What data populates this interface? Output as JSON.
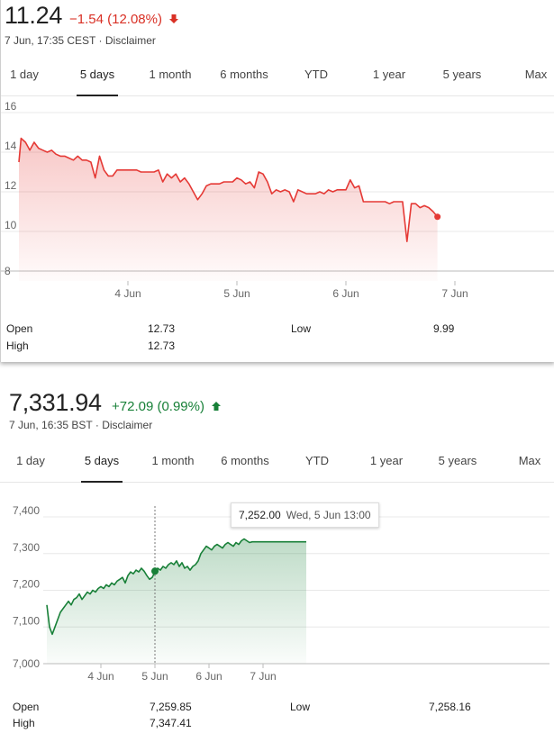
{
  "tabs": [
    "1 day",
    "5 days",
    "1 month",
    "6 months",
    "YTD",
    "1 year",
    "5 years",
    "Max"
  ],
  "active_tab": "5 days",
  "quotes": [
    {
      "price": "11.24",
      "change": "−1.54 (12.08%)",
      "direction": "down",
      "timestamp": "7 Jun, 17:35 CEST",
      "disclaimer": "Disclaimer",
      "color": "#d93025",
      "stats": {
        "open_label": "Open",
        "open": "12.73",
        "high_label": "High",
        "high": "12.73",
        "low_label": "Low",
        "low": "9.99"
      }
    },
    {
      "price": "7,331.94",
      "change": "+72.09 (0.99%)",
      "direction": "up",
      "timestamp": "7 Jun, 16:35 BST",
      "disclaimer": "Disclaimer",
      "color": "#188038",
      "stats": {
        "open_label": "Open",
        "open": "7,259.85",
        "high_label": "High",
        "high": "7,347.41",
        "low_label": "Low",
        "low": "7,258.16"
      },
      "tooltip": {
        "value": "7,252.00",
        "date": "Wed, 5 Jun 13:00"
      }
    }
  ],
  "chart_data": [
    {
      "type": "area",
      "x_tick_labels": [
        "4 Jun",
        "5 Jun",
        "6 Jun",
        "7 Jun"
      ],
      "y_tick_labels": [
        "16",
        "14",
        "12",
        "10",
        "8"
      ],
      "ylim": [
        8,
        16.5
      ],
      "grid": true,
      "color": "#e53935",
      "series": [
        {
          "x_day": [
            0,
            0.02,
            0.06,
            0.1,
            0.14,
            0.18,
            0.22,
            0.26,
            0.3,
            0.34,
            0.38,
            0.42,
            0.46,
            0.5,
            0.54,
            0.58,
            0.62,
            0.66,
            0.7,
            0.74,
            0.78,
            0.82,
            0.86,
            0.9,
            0.94,
            1.0,
            1.04,
            1.08,
            1.12,
            1.16,
            1.2,
            1.24,
            1.28,
            1.32,
            1.36,
            1.4,
            1.44,
            1.48,
            1.52,
            1.56,
            1.6,
            1.64,
            1.68,
            1.72,
            1.76,
            1.8,
            1.84,
            1.88,
            1.92,
            1.96,
            2.0,
            2.04,
            2.08,
            2.12,
            2.16,
            2.2,
            2.24,
            2.28,
            2.32,
            2.36,
            2.4,
            2.44,
            2.48,
            2.52,
            2.56,
            2.6,
            2.64,
            2.68,
            2.72,
            2.76,
            2.8,
            2.84,
            2.88,
            2.92,
            2.96,
            3.0,
            3.04,
            3.08,
            3.12,
            3.16,
            3.2,
            3.24,
            3.28,
            3.32,
            3.36,
            3.4,
            3.44,
            3.48,
            3.52,
            3.56,
            3.6,
            3.64,
            3.68,
            3.72,
            3.76,
            3.8,
            3.84
          ],
          "values": [
            14.0,
            15.2,
            15.0,
            14.6,
            15.0,
            14.7,
            14.6,
            14.5,
            14.6,
            14.4,
            14.3,
            14.3,
            14.2,
            14.1,
            14.3,
            14.1,
            14.1,
            14.0,
            13.2,
            14.3,
            13.6,
            13.3,
            13.3,
            13.6,
            13.6,
            13.6,
            13.6,
            13.6,
            13.5,
            13.5,
            13.5,
            13.5,
            13.6,
            13.0,
            13.4,
            13.2,
            13.4,
            13.0,
            13.2,
            12.9,
            12.5,
            12.1,
            12.4,
            12.8,
            12.9,
            12.9,
            12.9,
            13.0,
            13.0,
            13.0,
            13.2,
            13.1,
            12.9,
            13.0,
            12.7,
            13.5,
            13.4,
            13.0,
            12.4,
            12.6,
            12.5,
            12.6,
            12.5,
            12.0,
            12.6,
            12.5,
            12.4,
            12.4,
            12.4,
            12.5,
            12.4,
            12.6,
            12.5,
            12.6,
            12.6,
            12.6,
            13.1,
            12.7,
            12.8,
            12.0,
            12.0,
            12.0,
            12.0,
            12.0,
            12.0,
            11.9,
            12.0,
            12.0,
            12.0,
            9.99,
            11.9,
            11.9,
            11.7,
            11.8,
            11.7,
            11.5,
            11.24
          ]
        }
      ]
    },
    {
      "type": "area",
      "x_tick_labels": [
        "4 Jun",
        "5 Jun",
        "6 Jun",
        "7 Jun"
      ],
      "y_tick_labels": [
        "7,400",
        "7,300",
        "7,200",
        "7,100",
        "7,000"
      ],
      "ylim": [
        7000,
        7400
      ],
      "grid": true,
      "color": "#188038",
      "series": [
        {
          "x_day": [
            0,
            0.05,
            0.1,
            0.15,
            0.2,
            0.25,
            0.3,
            0.35,
            0.4,
            0.45,
            0.5,
            0.55,
            0.6,
            0.65,
            0.7,
            0.75,
            0.8,
            0.85,
            0.9,
            0.95,
            1.0,
            1.05,
            1.1,
            1.15,
            1.2,
            1.25,
            1.3,
            1.35,
            1.4,
            1.45,
            1.5,
            1.55,
            1.6,
            1.65,
            1.7,
            1.75,
            1.8,
            1.85,
            1.9,
            1.95,
            2.0,
            2.05,
            2.1,
            2.15,
            2.2,
            2.25,
            2.3,
            2.35,
            2.4,
            2.45,
            2.5,
            2.55,
            2.6,
            2.65,
            2.7,
            2.75,
            2.8,
            2.85,
            2.9,
            2.95,
            3.0,
            3.05,
            3.1,
            3.15,
            3.2,
            3.25,
            3.3,
            3.35,
            3.4,
            3.45,
            3.5,
            3.55,
            3.6,
            3.65,
            3.7,
            3.75,
            3.8,
            3.85,
            3.9,
            3.95,
            4.0,
            4.05,
            4.1,
            4.15,
            4.2,
            4.25,
            4.3,
            4.35,
            4.4,
            4.45,
            4.5,
            4.55,
            4.6,
            4.65,
            4.7,
            4.75,
            4.8
          ],
          "values": [
            7160,
            7100,
            7080,
            7100,
            7120,
            7140,
            7150,
            7160,
            7170,
            7160,
            7175,
            7180,
            7190,
            7175,
            7185,
            7195,
            7190,
            7200,
            7195,
            7205,
            7210,
            7205,
            7215,
            7210,
            7220,
            7215,
            7225,
            7230,
            7235,
            7220,
            7240,
            7250,
            7245,
            7255,
            7250,
            7260,
            7252,
            7240,
            7230,
            7235,
            7250,
            7260,
            7255,
            7265,
            7260,
            7270,
            7275,
            7270,
            7280,
            7265,
            7275,
            7260,
            7265,
            7255,
            7265,
            7270,
            7280,
            7300,
            7310,
            7320,
            7315,
            7310,
            7320,
            7325,
            7320,
            7315,
            7325,
            7330,
            7325,
            7320,
            7330,
            7325,
            7335,
            7340,
            7335,
            7330,
            7331.94,
            7331.94,
            7331.94,
            7331.94,
            7331.94,
            7331.94,
            7331.94,
            7331.94,
            7331.94,
            7331.94,
            7331.94,
            7331.94,
            7331.94,
            7331.94,
            7331.94,
            7331.94,
            7331.94,
            7331.94,
            7331.94,
            7331.94,
            7331.94
          ]
        }
      ]
    }
  ]
}
